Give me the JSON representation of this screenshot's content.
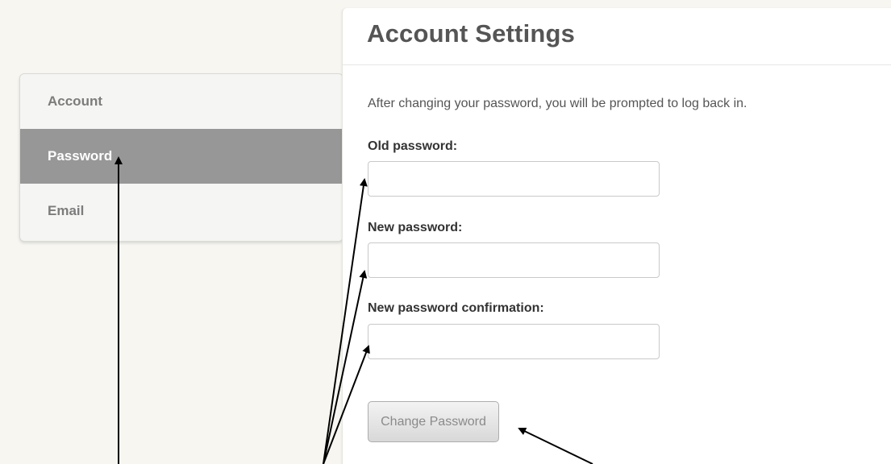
{
  "sidebar": {
    "items": [
      {
        "label": "Account",
        "active": false
      },
      {
        "label": "Password",
        "active": true
      },
      {
        "label": "Email",
        "active": false
      }
    ]
  },
  "panel": {
    "title": "Account Settings",
    "note": "After changing your password, you will be prompted to log back in."
  },
  "form": {
    "old_password_label": "Old password:",
    "old_password_value": "",
    "new_password_label": "New password:",
    "new_password_value": "",
    "confirm_label": "New password confirmation:",
    "confirm_value": "",
    "submit_label": "Change Password"
  },
  "colors": {
    "page_background": "#f7f6f1",
    "active_nav": "#979797",
    "annotation_arrow": "#000000"
  }
}
